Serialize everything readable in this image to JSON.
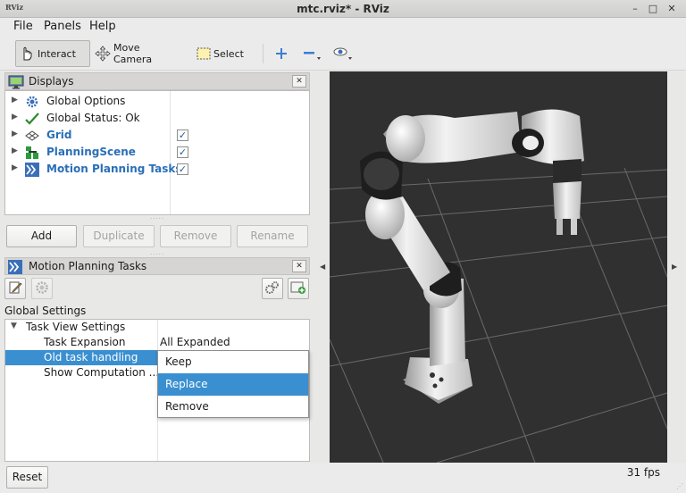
{
  "window": {
    "title": "mtc.rviz* - RViz",
    "app_icon_text": "RViz"
  },
  "menu": [
    "File",
    "Panels",
    "Help"
  ],
  "toolbar": {
    "interact": "Interact",
    "move_camera": "Move Camera",
    "select": "Select"
  },
  "displays": {
    "title": "Displays",
    "items": [
      {
        "label": "Global Options",
        "icon": "gear-icon"
      },
      {
        "label": "Global Status: Ok",
        "icon": "checkmark-icon"
      },
      {
        "label": "Grid",
        "icon": "grid-icon",
        "checked": true
      },
      {
        "label": "PlanningScene",
        "icon": "planning-scene-icon",
        "checked": true
      },
      {
        "label": "Motion Planning Tasks",
        "icon": "motion-planning-icon",
        "checked": true
      }
    ],
    "buttons": {
      "add": "Add",
      "duplicate": "Duplicate",
      "remove": "Remove",
      "rename": "Rename"
    }
  },
  "mpt": {
    "title": "Motion Planning Tasks",
    "global_settings": "Global Settings",
    "group": "Task View Settings",
    "props": [
      {
        "name": "Task Expansion",
        "value": "All Expanded"
      },
      {
        "name": "Old task handling",
        "value": ""
      },
      {
        "name": "Show Computation ...",
        "value": ""
      }
    ],
    "dropdown": {
      "options": [
        "Keep",
        "Replace",
        "Remove"
      ],
      "highlighted": "Replace"
    }
  },
  "status": {
    "reset": "Reset",
    "fps": "31 fps"
  },
  "colors": {
    "accent": "#3a8fd0",
    "link": "#2a6fb8",
    "viewport_bg": "#303030"
  }
}
